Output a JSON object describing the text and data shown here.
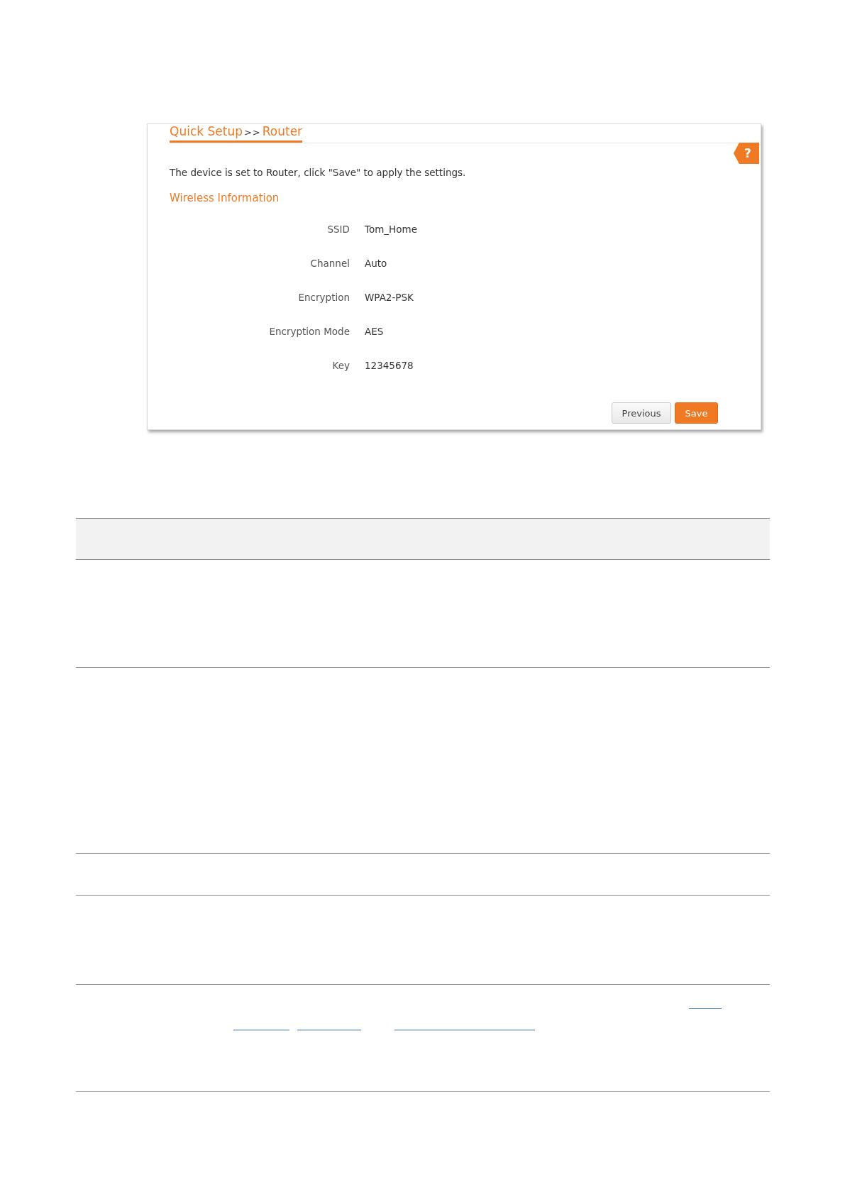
{
  "breadcrumb": [
    {
      "label": "Quick Setup"
    },
    {
      "label": "Router"
    }
  ],
  "separator": ">>",
  "help": "?",
  "message": "The device is set to Router, click \"Save\" to apply the settings.",
  "section_title": "Wireless Information",
  "fields": [
    {
      "label": "SSID",
      "value": "Tom_Home"
    },
    {
      "label": "Channel",
      "value": "Auto"
    },
    {
      "label": "Encryption",
      "value": "WPA2-PSK"
    },
    {
      "label": "Encryption Mode",
      "value": "AES"
    },
    {
      "label": "Key",
      "value": "12345678"
    }
  ],
  "buttons": [
    {
      "label": "Previous",
      "kind": "secondary"
    },
    {
      "label": "Save",
      "kind": "primary"
    }
  ]
}
